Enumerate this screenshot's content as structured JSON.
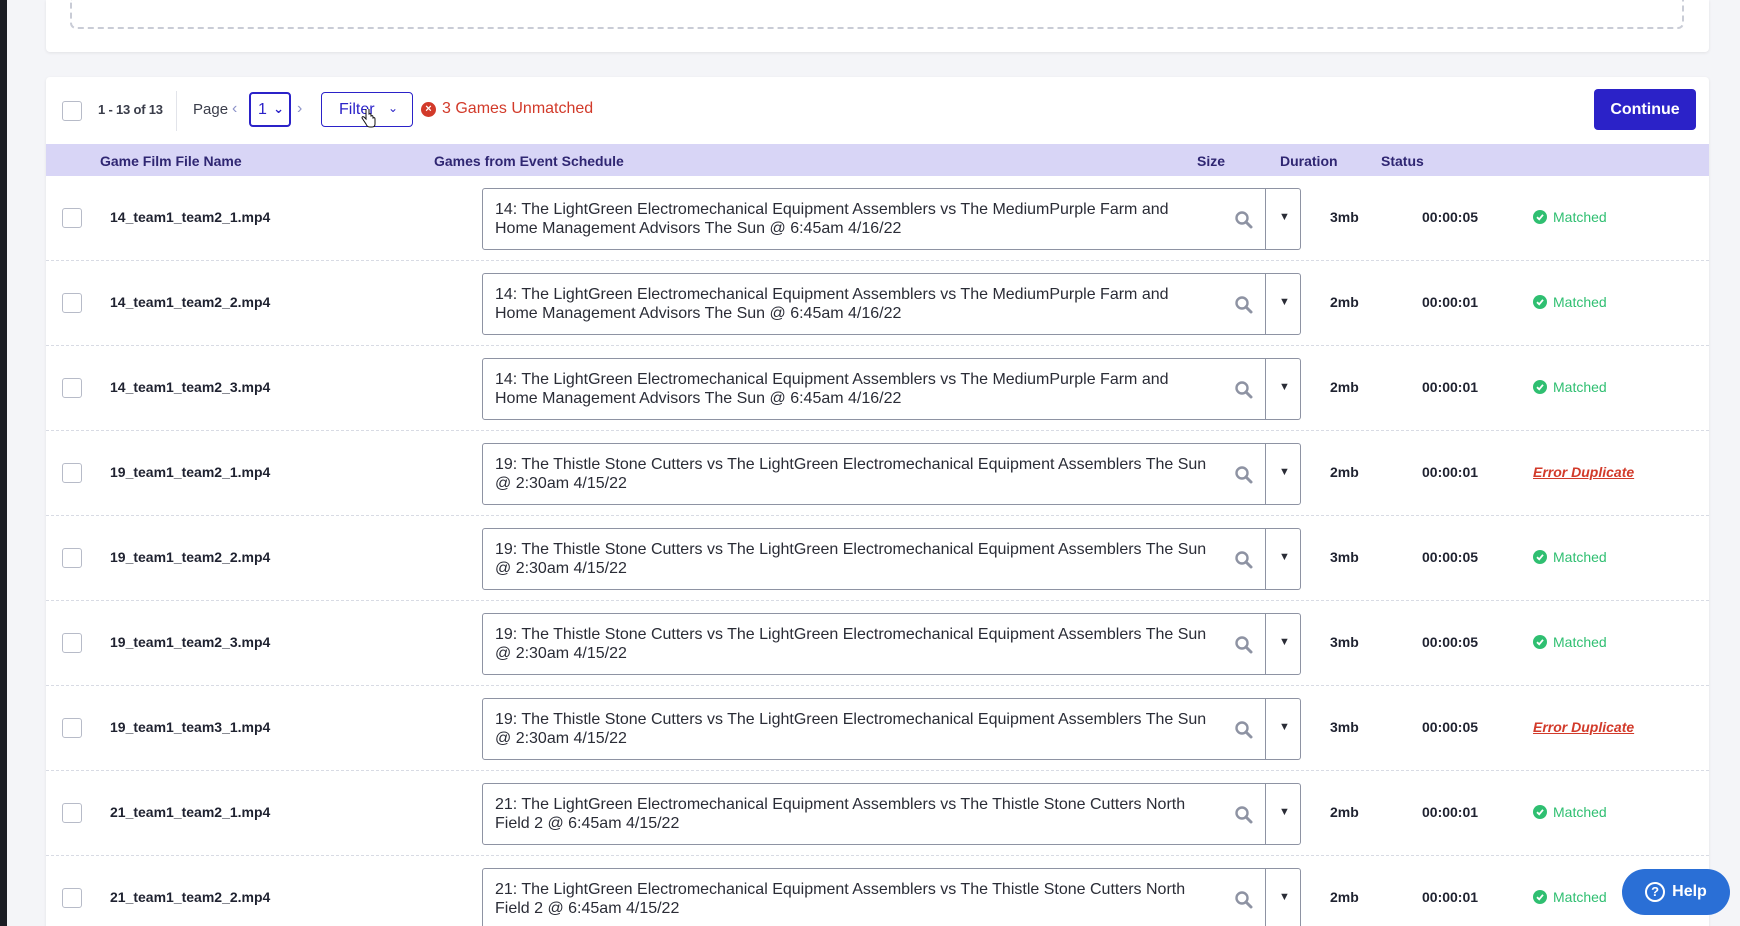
{
  "toolbar": {
    "range": "1 - 13 of 13",
    "page_label": "Page",
    "page_value": "1",
    "filter_label": "Filter",
    "unmatched_text": "3 Games Unmatched",
    "continue_label": "Continue"
  },
  "table": {
    "headers": {
      "file_name": "Game Film File Name",
      "games": "Games from Event Schedule",
      "size": "Size",
      "duration": "Duration",
      "status": "Status"
    },
    "rows": [
      {
        "file": "14_team1_team2_1.mp4",
        "game": "14: The LightGreen Electromechanical Equipment Assemblers vs The MediumPurple Farm and Home Management Advisors The Sun @ 6:45am 4/16/22",
        "size": "3mb",
        "duration": "00:00:05",
        "status": "Matched",
        "status_type": "ok"
      },
      {
        "file": "14_team1_team2_2.mp4",
        "game": "14: The LightGreen Electromechanical Equipment Assemblers vs The MediumPurple Farm and Home Management Advisors The Sun @ 6:45am 4/16/22",
        "size": "2mb",
        "duration": "00:00:01",
        "status": "Matched",
        "status_type": "ok"
      },
      {
        "file": "14_team1_team2_3.mp4",
        "game": "14: The LightGreen Electromechanical Equipment Assemblers vs The MediumPurple Farm and Home Management Advisors The Sun @ 6:45am 4/16/22",
        "size": "2mb",
        "duration": "00:00:01",
        "status": "Matched",
        "status_type": "ok"
      },
      {
        "file": "19_team1_team2_1.mp4",
        "game": "19: The Thistle Stone Cutters vs The LightGreen Electromechanical Equipment Assemblers The Sun @ 2:30am 4/15/22",
        "size": "2mb",
        "duration": "00:00:01",
        "status": "Error Duplicate",
        "status_type": "err"
      },
      {
        "file": "19_team1_team2_2.mp4",
        "game": "19: The Thistle Stone Cutters vs The LightGreen Electromechanical Equipment Assemblers The Sun @ 2:30am 4/15/22",
        "size": "3mb",
        "duration": "00:00:05",
        "status": "Matched",
        "status_type": "ok"
      },
      {
        "file": "19_team1_team2_3.mp4",
        "game": "19: The Thistle Stone Cutters vs The LightGreen Electromechanical Equipment Assemblers The Sun @ 2:30am 4/15/22",
        "size": "3mb",
        "duration": "00:00:05",
        "status": "Matched",
        "status_type": "ok"
      },
      {
        "file": "19_team1_team3_1.mp4",
        "game": "19: The Thistle Stone Cutters vs The LightGreen Electromechanical Equipment Assemblers The Sun @ 2:30am 4/15/22",
        "size": "3mb",
        "duration": "00:00:05",
        "status": "Error Duplicate",
        "status_type": "err"
      },
      {
        "file": "21_team1_team2_1.mp4",
        "game": "21: The LightGreen Electromechanical Equipment Assemblers vs The Thistle Stone Cutters North Field 2 @ 6:45am 4/15/22",
        "size": "2mb",
        "duration": "00:00:01",
        "status": "Matched",
        "status_type": "ok"
      },
      {
        "file": "21_team1_team2_2.mp4",
        "game": "21: The LightGreen Electromechanical Equipment Assemblers vs The Thistle Stone Cutters North Field 2 @ 6:45am 4/15/22",
        "size": "2mb",
        "duration": "00:00:01",
        "status": "Matched",
        "status_type": "ok"
      }
    ]
  },
  "help": {
    "label": "Help"
  },
  "colors": {
    "accent": "#2b22c8",
    "header_bg": "#d8d5f6",
    "matched": "#2fbf71",
    "error": "#d23a2a",
    "help": "#2a6fd6"
  }
}
